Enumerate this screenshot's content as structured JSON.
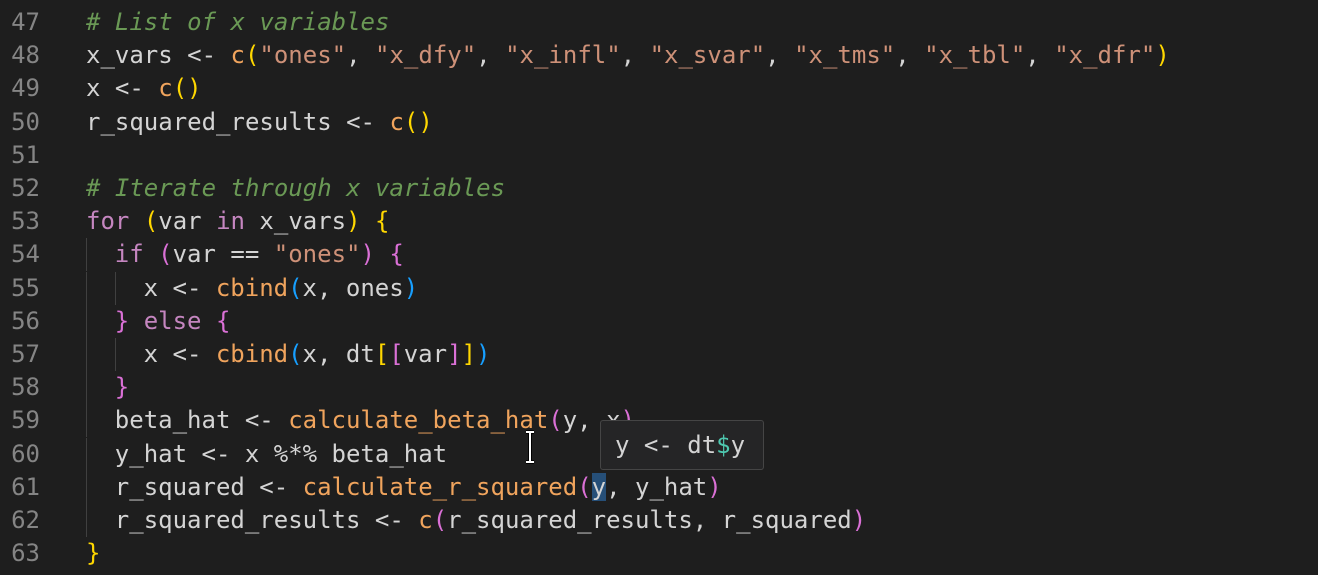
{
  "editor": {
    "lines": [
      {
        "n": "47",
        "indent": 0,
        "tokens": [
          {
            "t": "# List of x variables",
            "c": "cm"
          }
        ]
      },
      {
        "n": "48",
        "indent": 0,
        "tokens": [
          {
            "t": "x_vars <- ",
            "c": "var"
          },
          {
            "t": "c",
            "c": "call"
          },
          {
            "t": "(",
            "c": "p1"
          },
          {
            "t": "\"ones\"",
            "c": "str"
          },
          {
            "t": ", ",
            "c": "var"
          },
          {
            "t": "\"x_dfy\"",
            "c": "str"
          },
          {
            "t": ", ",
            "c": "var"
          },
          {
            "t": "\"x_infl\"",
            "c": "str"
          },
          {
            "t": ", ",
            "c": "var"
          },
          {
            "t": "\"x_svar\"",
            "c": "str"
          },
          {
            "t": ", ",
            "c": "var"
          },
          {
            "t": "\"x_tms\"",
            "c": "str"
          },
          {
            "t": ", ",
            "c": "var"
          },
          {
            "t": "\"x_tbl\"",
            "c": "str"
          },
          {
            "t": ", ",
            "c": "var"
          },
          {
            "t": "\"x_dfr\"",
            "c": "str"
          },
          {
            "t": ")",
            "c": "p1"
          }
        ]
      },
      {
        "n": "49",
        "indent": 0,
        "tokens": [
          {
            "t": "x <- ",
            "c": "var"
          },
          {
            "t": "c",
            "c": "call"
          },
          {
            "t": "()",
            "c": "p1"
          }
        ]
      },
      {
        "n": "50",
        "indent": 0,
        "tokens": [
          {
            "t": "r_squared_results <- ",
            "c": "var"
          },
          {
            "t": "c",
            "c": "call"
          },
          {
            "t": "()",
            "c": "p1"
          }
        ]
      },
      {
        "n": "51",
        "indent": 0,
        "tokens": []
      },
      {
        "n": "52",
        "indent": 0,
        "tokens": [
          {
            "t": "# Iterate through x variables",
            "c": "cm"
          }
        ]
      },
      {
        "n": "53",
        "indent": 0,
        "tokens": [
          {
            "t": "for",
            "c": "kw"
          },
          {
            "t": " ",
            "c": "var"
          },
          {
            "t": "(",
            "c": "p1"
          },
          {
            "t": "var ",
            "c": "var"
          },
          {
            "t": "in",
            "c": "kw"
          },
          {
            "t": " x_vars",
            "c": "var"
          },
          {
            "t": ")",
            "c": "p1"
          },
          {
            "t": " ",
            "c": "var"
          },
          {
            "t": "{",
            "c": "p1"
          }
        ]
      },
      {
        "n": "54",
        "indent": 1,
        "tokens": [
          {
            "t": "if",
            "c": "kw"
          },
          {
            "t": " ",
            "c": "var"
          },
          {
            "t": "(",
            "c": "p2"
          },
          {
            "t": "var == ",
            "c": "var"
          },
          {
            "t": "\"ones\"",
            "c": "str"
          },
          {
            "t": ")",
            "c": "p2"
          },
          {
            "t": " ",
            "c": "var"
          },
          {
            "t": "{",
            "c": "p2"
          }
        ]
      },
      {
        "n": "55",
        "indent": 2,
        "tokens": [
          {
            "t": "x <- ",
            "c": "var"
          },
          {
            "t": "cbind",
            "c": "call"
          },
          {
            "t": "(",
            "c": "p3"
          },
          {
            "t": "x, ones",
            "c": "var"
          },
          {
            "t": ")",
            "c": "p3"
          }
        ]
      },
      {
        "n": "56",
        "indent": 1,
        "tokens": [
          {
            "t": "}",
            "c": "p2"
          },
          {
            "t": " ",
            "c": "var"
          },
          {
            "t": "else",
            "c": "kw"
          },
          {
            "t": " ",
            "c": "var"
          },
          {
            "t": "{",
            "c": "p2"
          }
        ]
      },
      {
        "n": "57",
        "indent": 2,
        "tokens": [
          {
            "t": "x <- ",
            "c": "var"
          },
          {
            "t": "cbind",
            "c": "call"
          },
          {
            "t": "(",
            "c": "p3"
          },
          {
            "t": "x, dt",
            "c": "var"
          },
          {
            "t": "[",
            "c": "p1"
          },
          {
            "t": "[",
            "c": "p2"
          },
          {
            "t": "var",
            "c": "var"
          },
          {
            "t": "]",
            "c": "p2"
          },
          {
            "t": "]",
            "c": "p1"
          },
          {
            "t": ")",
            "c": "p3"
          }
        ]
      },
      {
        "n": "58",
        "indent": 1,
        "tokens": [
          {
            "t": "}",
            "c": "p2"
          }
        ]
      },
      {
        "n": "59",
        "indent": 1,
        "tokens": [
          {
            "t": "beta_hat <- ",
            "c": "var"
          },
          {
            "t": "calculate_beta_hat",
            "c": "call"
          },
          {
            "t": "(",
            "c": "p2"
          },
          {
            "t": "y, x",
            "c": "var"
          },
          {
            "t": ")",
            "c": "p2"
          }
        ]
      },
      {
        "n": "60",
        "indent": 1,
        "tokens": [
          {
            "t": "y_hat <- x %*% beta_hat",
            "c": "var"
          }
        ]
      },
      {
        "n": "61",
        "indent": 1,
        "tokens": [
          {
            "t": "r_squared <- ",
            "c": "var"
          },
          {
            "t": "calculate_r_squared",
            "c": "call"
          },
          {
            "t": "(",
            "c": "p2"
          },
          {
            "t": "y",
            "c": "var",
            "sel": true
          },
          {
            "t": ", y_hat",
            "c": "var"
          },
          {
            "t": ")",
            "c": "p2"
          }
        ]
      },
      {
        "n": "62",
        "indent": 1,
        "tokens": [
          {
            "t": "r_squared_results <- ",
            "c": "var"
          },
          {
            "t": "c",
            "c": "call"
          },
          {
            "t": "(",
            "c": "p2"
          },
          {
            "t": "r_squared_results, r_squared",
            "c": "var"
          },
          {
            "t": ")",
            "c": "p2"
          }
        ]
      },
      {
        "n": "63",
        "indent": 0,
        "tokens": [
          {
            "t": "}",
            "c": "p1"
          }
        ]
      }
    ]
  },
  "hover": {
    "prefix": "y <- dt",
    "accessor": "$",
    "suffix": "y"
  },
  "colors": {
    "background": "#1e1e1e",
    "comment": "#6a9955",
    "keyword": "#c586c0",
    "string": "#ce9178",
    "function_call": "#f0a45d",
    "bracket_level_1": "#ffd700",
    "bracket_level_2": "#da70d6",
    "bracket_level_3": "#179fff",
    "line_number": "#858585"
  },
  "icons": {
    "cursor": "text-cursor-icon"
  }
}
